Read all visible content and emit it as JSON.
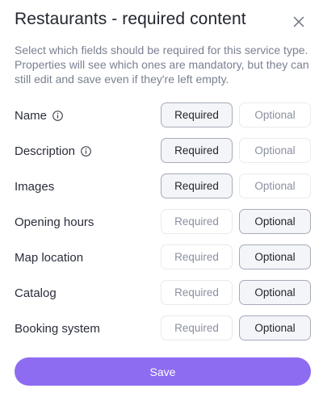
{
  "dialog": {
    "title": "Restaurants - required content",
    "description": "Select which fields should be required for this service type. Properties will see which ones are mandatory, but they can still edit and save even if they're left empty."
  },
  "options": {
    "required_label": "Required",
    "optional_label": "Optional"
  },
  "fields": [
    {
      "label": "Name",
      "has_info": true,
      "selected": "Required"
    },
    {
      "label": "Description",
      "has_info": true,
      "selected": "Required"
    },
    {
      "label": "Images",
      "has_info": false,
      "selected": "Required"
    },
    {
      "label": "Opening hours",
      "has_info": false,
      "selected": "Optional"
    },
    {
      "label": "Map location",
      "has_info": false,
      "selected": "Optional"
    },
    {
      "label": "Catalog",
      "has_info": false,
      "selected": "Optional"
    },
    {
      "label": "Booking system",
      "has_info": false,
      "selected": "Optional"
    }
  ],
  "footer": {
    "save_label": "Save"
  },
  "colors": {
    "accent": "#8e6cf2",
    "title": "#23262f",
    "description": "#7a8091"
  },
  "icons": {
    "close": "close-icon",
    "info": "info-icon"
  }
}
